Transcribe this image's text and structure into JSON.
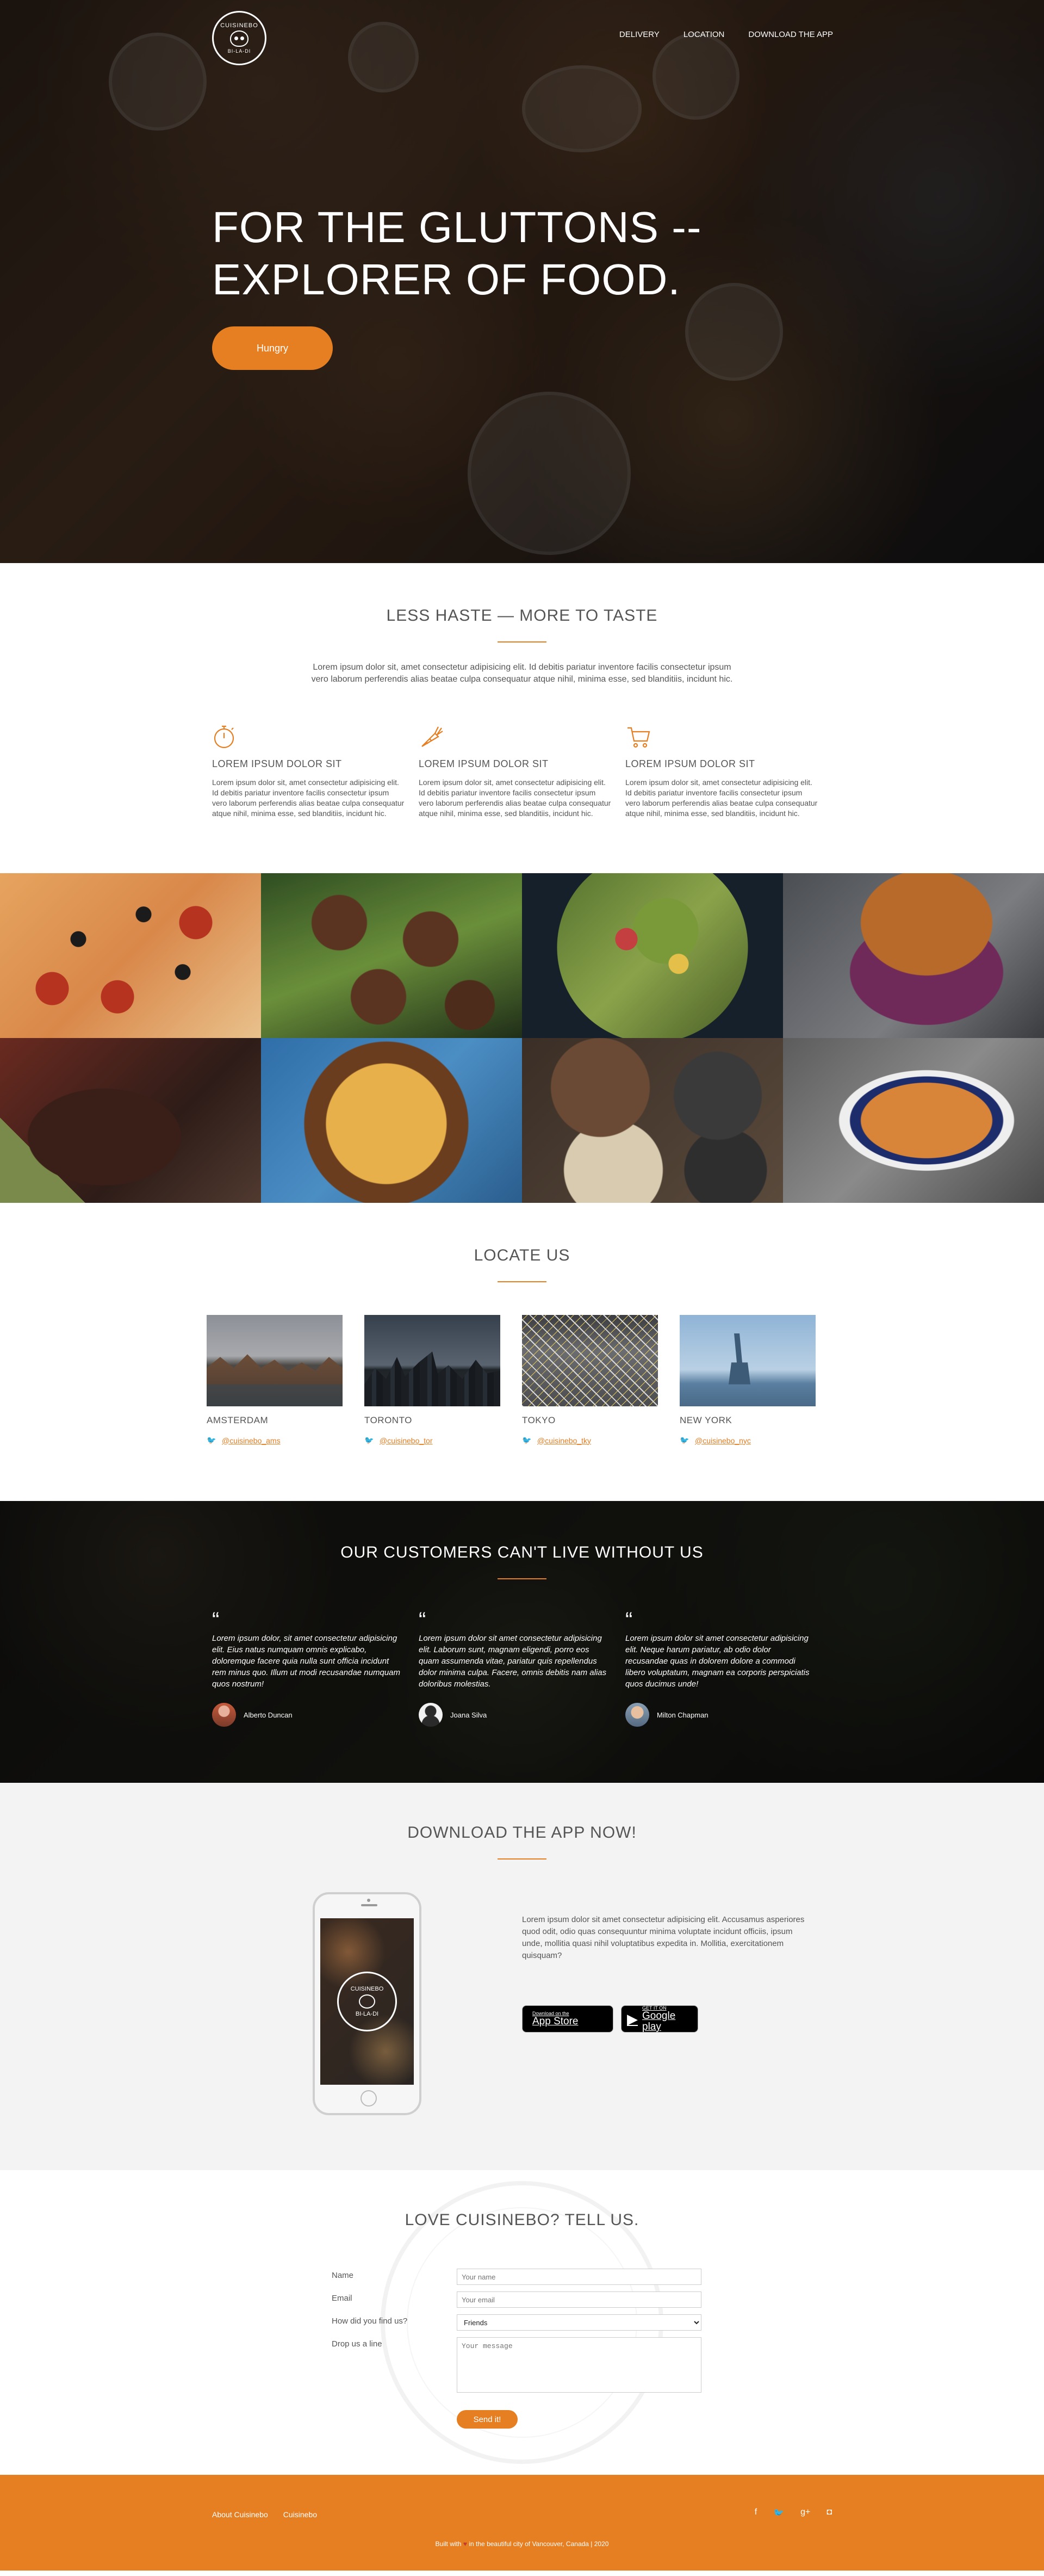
{
  "colors": {
    "accent": "#e67e22",
    "footer_bg": "#e67e22"
  },
  "header": {
    "logo": {
      "top": "CUISINEBO",
      "bottom": "BI-LA-DI"
    },
    "nav": [
      "DELIVERY",
      "LOCATION",
      "DOWNLOAD THE APP"
    ],
    "hero_title_line1": "FOR THE GLUTTONS --",
    "hero_title_line2": "EXPLORER OF FOOD.",
    "cta_label": "Hungry"
  },
  "features": {
    "heading": "LESS HASTE — MORE TO TASTE",
    "intro": "Lorem ipsum dolor sit, amet consectetur adipisicing elit. Id debitis pariatur inventore facilis consectetur ipsum vero laborum perferendis alias beatae culpa consequatur atque nihil, minima esse, sed blanditiis, incidunt hic.",
    "items": [
      {
        "icon": "stopwatch-icon",
        "title": "LOREM IPSUM DOLOR SIT",
        "text": "Lorem ipsum dolor sit, amet consectetur adipisicing elit. Id debitis pariatur inventore facilis consectetur ipsum vero laborum perferendis alias beatae culpa consequatur atque nihil, minima esse, sed blanditiis, incidunt hic."
      },
      {
        "icon": "carrot-icon",
        "title": "LOREM IPSUM DOLOR SIT",
        "text": "Lorem ipsum dolor sit, amet consectetur adipisicing elit. Id debitis pariatur inventore facilis consectetur ipsum vero laborum perferendis alias beatae culpa consequatur atque nihil, minima esse, sed blanditiis, incidunt hic."
      },
      {
        "icon": "cart-icon",
        "title": "LOREM IPSUM DOLOR SIT",
        "text": "Lorem ipsum dolor sit, amet consectetur adipisicing elit. Id debitis pariatur inventore facilis consectetur ipsum vero laborum perferendis alias beatae culpa consequatur atque nihil, minima esse, sed blanditiis, incidunt hic."
      }
    ]
  },
  "locate": {
    "heading": "LOCATE US",
    "cities": [
      {
        "name": "AMSTERDAM",
        "handle": "@cuisinebo_ams"
      },
      {
        "name": "TORONTO",
        "handle": "@cuisinebo_tor"
      },
      {
        "name": "TOKYO",
        "handle": "@cuisinebo_tky"
      },
      {
        "name": "NEW YORK",
        "handle": "@cuisinebo_nyc"
      }
    ]
  },
  "testimonials": {
    "heading": "OUR CUSTOMERS CAN'T LIVE WITHOUT US",
    "items": [
      {
        "text": "Lorem ipsum dolor, sit amet consectetur adipisicing elit. Eius natus numquam omnis explicabo, doloremque facere quia nulla sunt officia incidunt rem minus quo. Illum ut modi recusandae numquam quos nostrum!",
        "name": "Alberto Duncan"
      },
      {
        "text": "Lorem ipsum dolor sit amet consectetur adipisicing elit. Laborum sunt, magnam eligendi, porro eos quam assumenda vitae, pariatur quis repellendus dolor minima culpa. Facere, omnis debitis nam alias doloribus molestias.",
        "name": "Joana Silva"
      },
      {
        "text": "Lorem ipsum dolor sit amet consectetur adipisicing elit. Neque harum pariatur, ab odio dolor recusandae quas in dolorem dolore a commodi libero voluptatum, magnam ea corporis perspiciatis quos ducimus unde!",
        "name": "Milton Chapman"
      }
    ]
  },
  "app": {
    "heading": "DOWNLOAD THE APP NOW!",
    "text": "Lorem ipsum dolor sit amet consectetur adipisicing elit. Accusamus asperiores quod odit, odio quas consequuntur minima voluptate incidunt officiis, ipsum unde, mollitia quasi nihil voluptatibus expedita in. Mollitia, exercitationem quisquam?",
    "phone_logo_top": "CUISINEBO",
    "phone_logo_bottom": "BI-LA-DI",
    "appstore_small": "Download on the",
    "appstore_big": "App Store",
    "gplay_small": "GET IT ON",
    "gplay_big": "Google play"
  },
  "contact": {
    "heading": "LOVE CUISINEBO? TELL US.",
    "name_label": "Name",
    "name_placeholder": "Your name",
    "email_label": "Email",
    "email_placeholder": "Your email",
    "find_label": "How did you find us?",
    "find_selected": "Friends",
    "message_label": "Drop us a line",
    "message_placeholder": "Your message",
    "send_label": "Send it!"
  },
  "footer": {
    "links": [
      "About Cuisinebo",
      "Cuisinebo"
    ],
    "social": [
      "facebook-icon",
      "twitter-icon",
      "google-plus-icon",
      "instagram-icon"
    ],
    "built_prefix": "Built with",
    "built_suffix": "in the beautiful city of Vancouver, Canada | 2020"
  }
}
